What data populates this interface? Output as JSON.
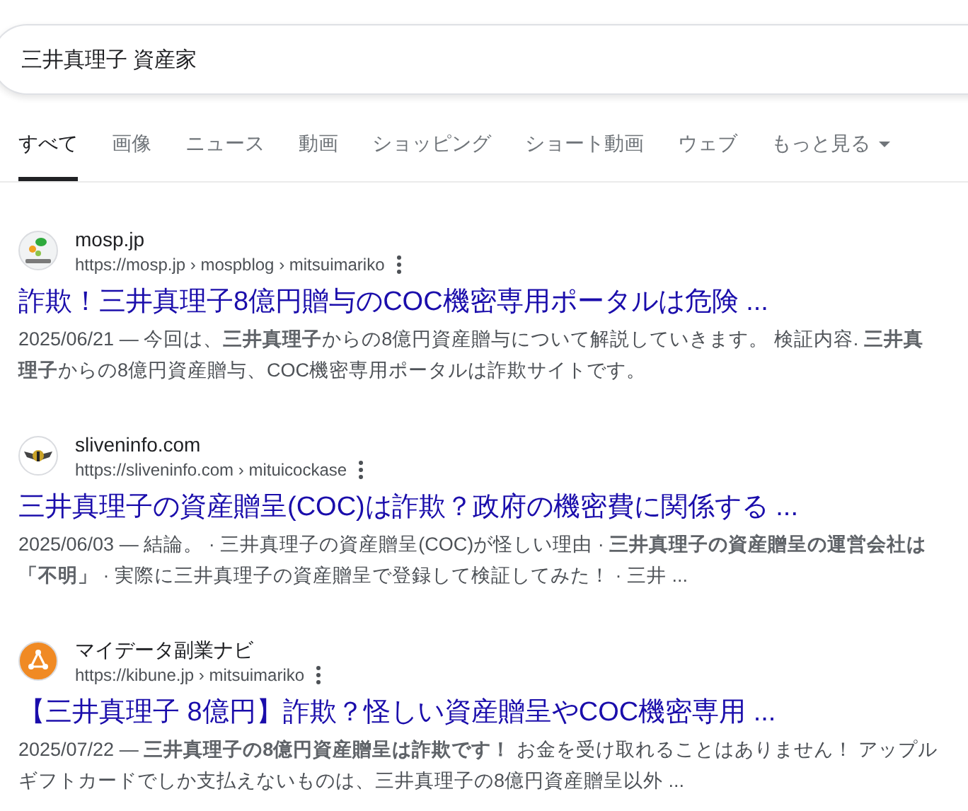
{
  "search": {
    "value": "三井真理子 資産家"
  },
  "tabs": [
    {
      "label": "すべて",
      "selected": true
    },
    {
      "label": "画像",
      "selected": false
    },
    {
      "label": "ニュース",
      "selected": false
    },
    {
      "label": "動画",
      "selected": false
    },
    {
      "label": "ショッピング",
      "selected": false
    },
    {
      "label": "ショート動画",
      "selected": false
    },
    {
      "label": "ウェブ",
      "selected": false
    },
    {
      "label": "もっと見る",
      "selected": false,
      "kind": "menu"
    }
  ],
  "results": [
    {
      "site": "mosp.jp",
      "url": "https://mosp.jp › mospblog › mitsuimariko",
      "kind": "leaf",
      "title": "詐欺！三井真理子8億円贈与のCOC機密専用ポータルは危険 ...",
      "date": "2025/06/21 —",
      "snippet": "今回は、**三井真理子**からの8億円資産贈与について解説していきます。 検証内容. **三井真理子**からの8億円資産贈与、COC機密専用ポータルは詐欺サイトです。"
    },
    {
      "site": "sliveninfo.com",
      "url": "https://sliveninfo.com › mituicockase",
      "kind": "wings",
      "title": "三井真理子の資産贈呈(COC)は詐欺？政府の機密費に関係する ...",
      "date": "2025/06/03 —",
      "snippet": "結論。 · 三井真理子の資産贈呈(COC)が怪しい理由 · **三井真理子の資産贈呈の運営会社は「不明」** · 実際に三井真理子の資産贈呈で登録して検証してみた！ · 三井 ..."
    },
    {
      "site": "マイデータ副業ナビ",
      "url": "https://kibune.jp › mitsuimariko",
      "kind": "nodes",
      "title": "【三井真理子 8億円】詐欺？怪しい資産贈呈やCOC機密専用 ...",
      "date": "2025/07/22 —",
      "snippet": "**三井真理子の8億円資産贈呈は詐欺です！** お金を受け取れることはありません！ アップルギフトカードでしか支払えないものは、三井真理子の8億円資産贈呈以外 ..."
    }
  ]
}
